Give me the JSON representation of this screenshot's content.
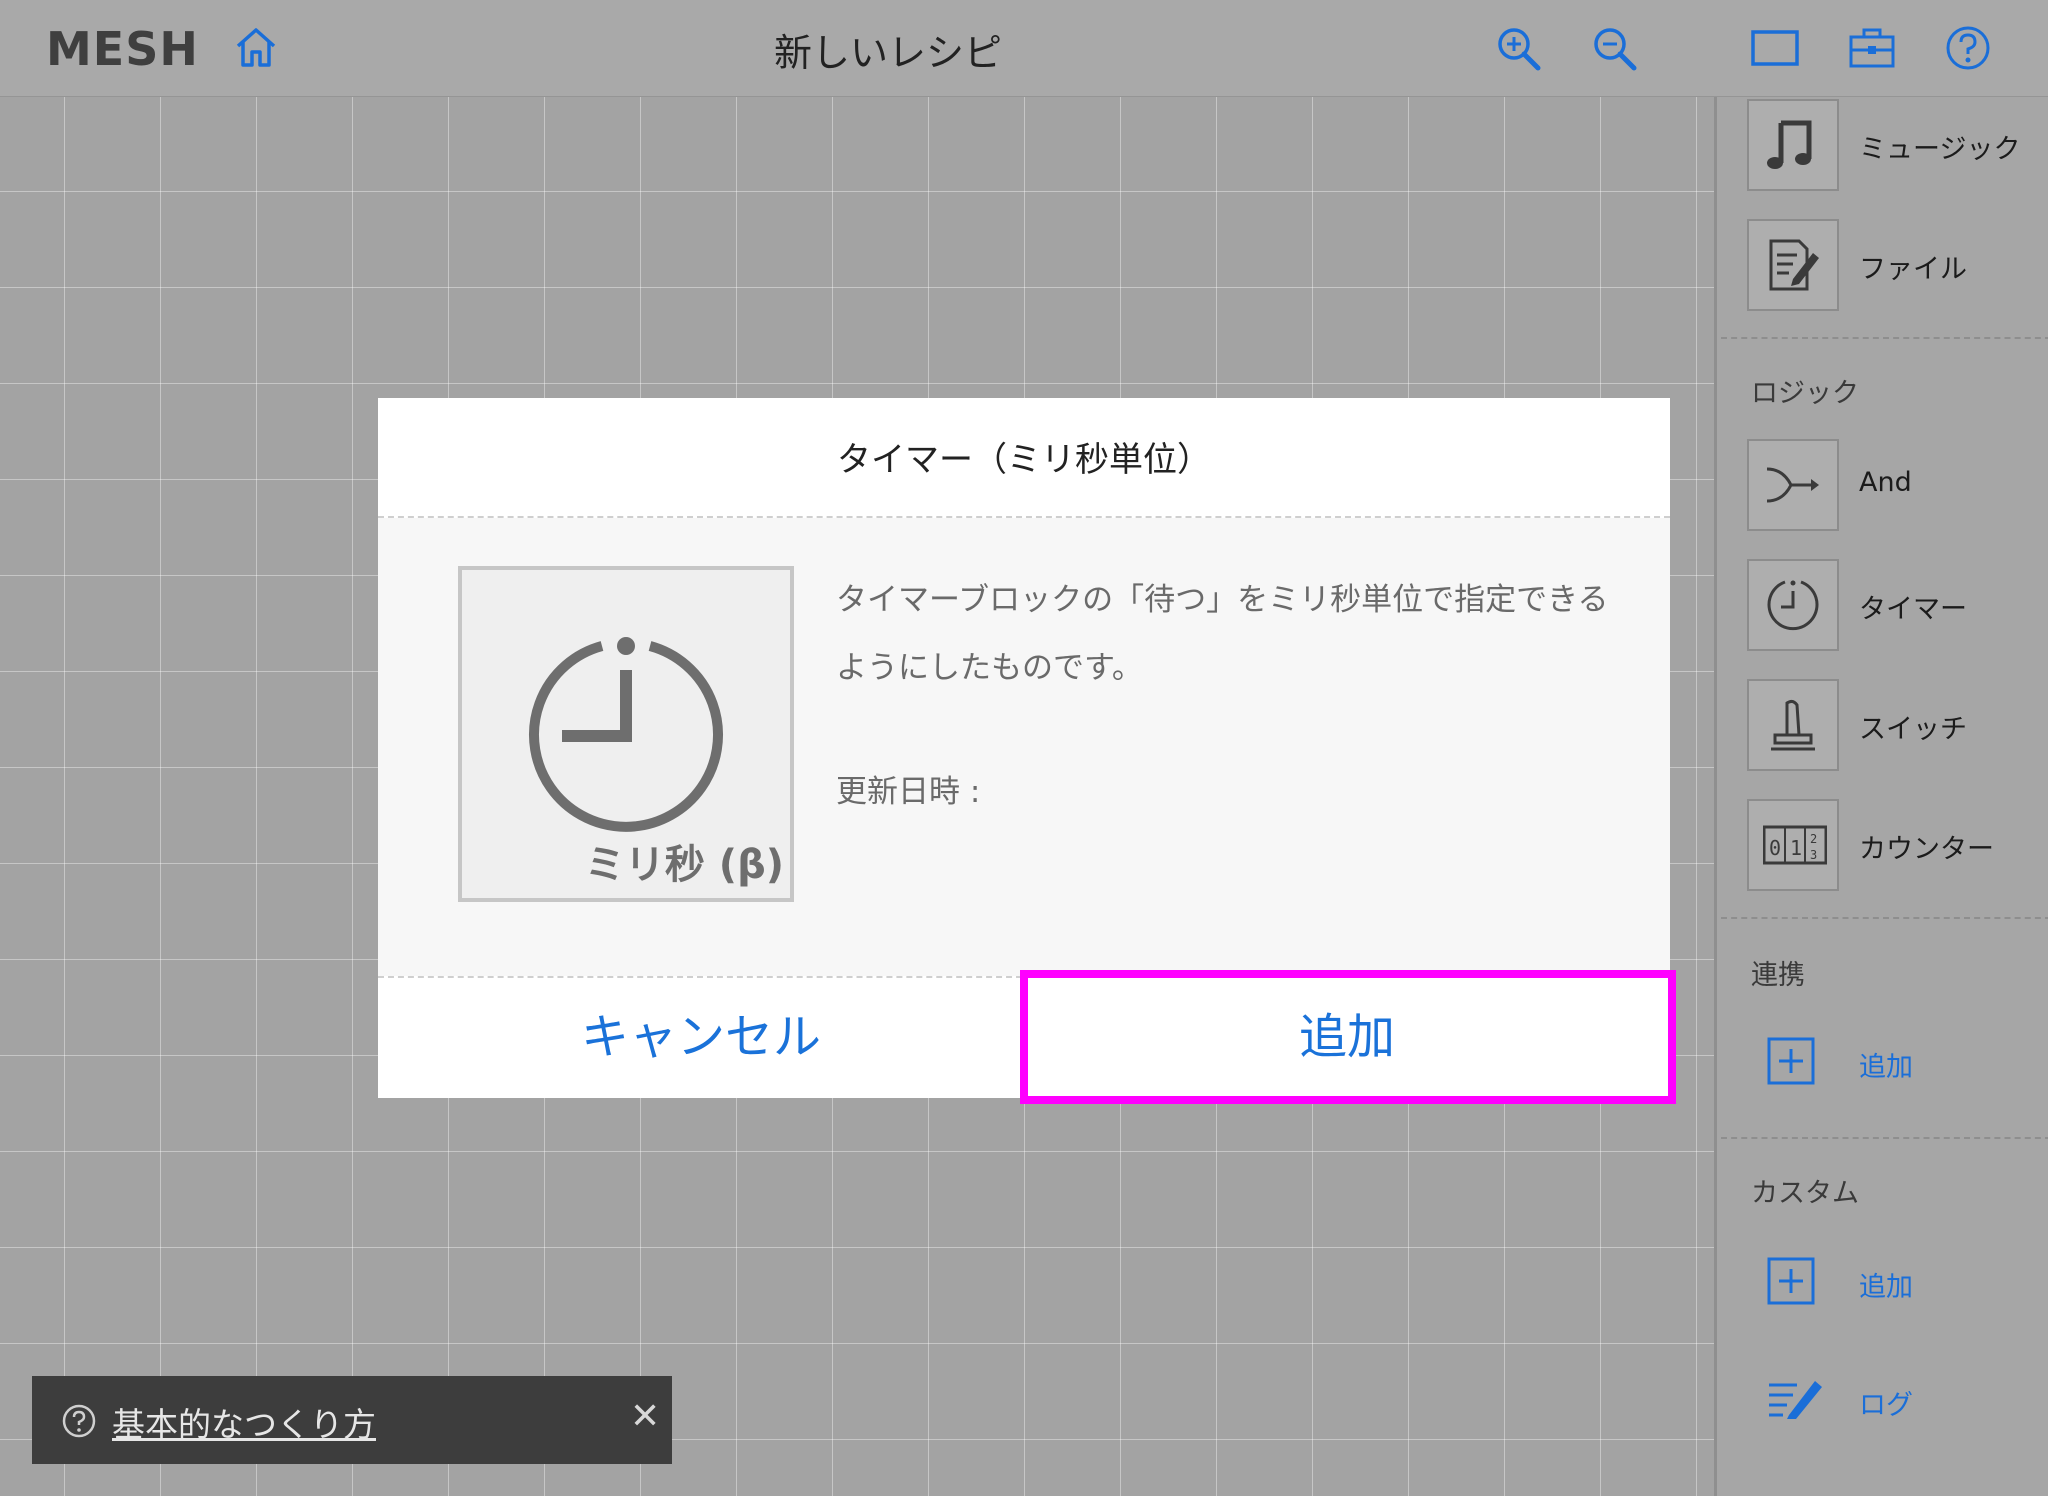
{
  "header": {
    "logo": "MESH",
    "title": "新しいレシピ",
    "icons": [
      "home-icon",
      "zoom-in-icon",
      "zoom-out-icon",
      "canvas-frame-icon",
      "toolbox-icon",
      "help-icon"
    ]
  },
  "sidebar": {
    "items_top": [
      {
        "label": "ミュージック",
        "icon": "music-note-icon"
      },
      {
        "label": "ファイル",
        "icon": "file-edit-icon"
      }
    ],
    "logic": {
      "title": "ロジック",
      "items": [
        {
          "label": "And",
          "icon": "and-icon"
        },
        {
          "label": "タイマー",
          "icon": "timer-icon"
        },
        {
          "label": "スイッチ",
          "icon": "switch-icon"
        },
        {
          "label": "カウンター",
          "icon": "counter-icon"
        }
      ]
    },
    "link": {
      "title": "連携",
      "add_label": "追加"
    },
    "custom": {
      "title": "カスタム",
      "add_label": "追加"
    },
    "log_label": "ログ"
  },
  "dialog": {
    "title": "タイマー（ミリ秒単位）",
    "thumb_label": "ミリ秒 (β)",
    "description": "タイマーブロックの「待つ」をミリ秒単位で指定できるようにしたものです。",
    "updated_label": "更新日時 :",
    "cancel_label": "キャンセル",
    "add_label": "追加"
  },
  "toast": {
    "text": "基本的なつくり方",
    "close": "✕"
  },
  "colors": {
    "accent": "#1a72d9",
    "highlight": "#ff00ff"
  }
}
